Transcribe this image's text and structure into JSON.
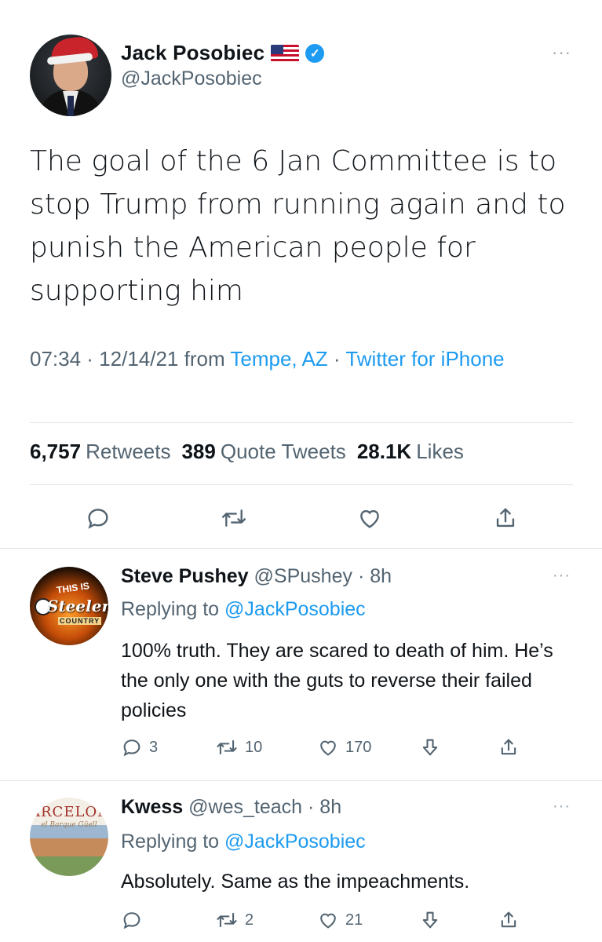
{
  "tweet": {
    "author": {
      "name": "Jack Posobiec",
      "handle": "@JackPosobiec",
      "flag_icon": "us-flag-icon",
      "verified_icon": "verified-badge-icon"
    },
    "more_label": "···",
    "text": "The goal of the 6 Jan Committee is to stop Trump from running again and to punish the American people for supporting him",
    "meta": {
      "time": "07:34",
      "sep1": " · ",
      "date": "12/14/21",
      "from_word": " from ",
      "location": "Tempe, AZ",
      "sep2": " · ",
      "client": "Twitter for iPhone"
    },
    "stats": {
      "retweets_count": "6,757",
      "retweets_label": "Retweets",
      "quotes_count": "389",
      "quotes_label": "Quote Tweets",
      "likes_count": "28.1K",
      "likes_label": "Likes"
    },
    "actions": [
      "reply-icon",
      "retweet-icon",
      "like-icon",
      "share-icon"
    ]
  },
  "replies": [
    {
      "name": "Steve Pushey",
      "handle": "@SPushey",
      "time": " · 8h",
      "replying_prefix": "Replying to ",
      "replying_to": "@JackPosobiec",
      "text": "100% truth.  They are scared to death of him.  He’s the only one with the guts to reverse their failed policies",
      "avatar_text": {
        "top": "THIS IS",
        "main": "Steeler",
        "bottom": "COUNTRY"
      },
      "counts": {
        "replies": "3",
        "retweets": "10",
        "likes": "170"
      }
    },
    {
      "name": "Kwess",
      "handle": "@wes_teach",
      "time": " · 8h",
      "replying_prefix": "Replying to ",
      "replying_to": "@JackPosobiec",
      "text": "Absolutely. Same as the impeachments.",
      "avatar_text": {
        "top": "ARCELON",
        "sub": "el Barque Güell"
      },
      "counts": {
        "replies": "",
        "retweets": "2",
        "likes": "21"
      }
    }
  ],
  "colors": {
    "accent": "#1d9bf0",
    "secondary_text": "#536471",
    "divider": "#dfe3e6"
  }
}
